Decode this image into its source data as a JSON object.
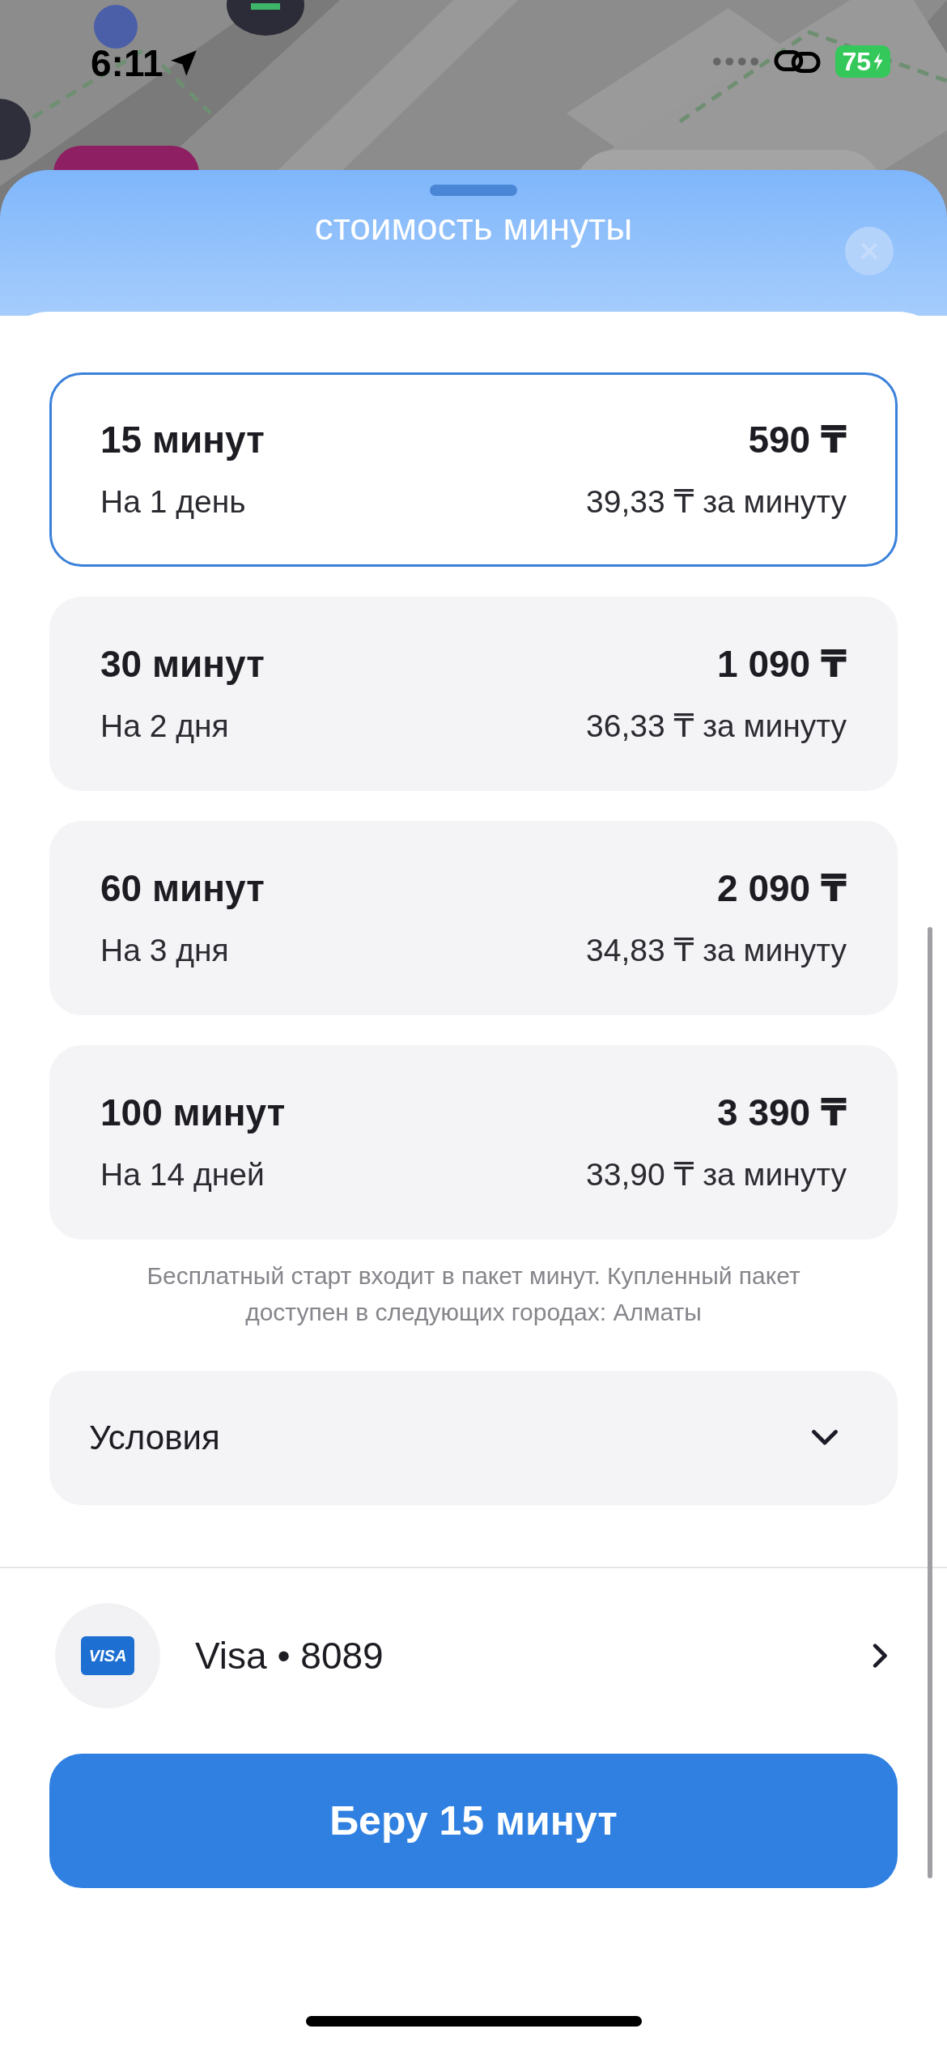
{
  "status_bar": {
    "time": "6:11",
    "battery": "75"
  },
  "sheet": {
    "title": "стоимость минуты"
  },
  "plans": [
    {
      "name": "15 минут",
      "period": "На 1 день",
      "price": "590 ₸",
      "per_minute": "39,33 ₸ за минуту",
      "selected": true
    },
    {
      "name": "30 минут",
      "period": "На 2 дня",
      "price": "1 090 ₸",
      "per_minute": "36,33 ₸ за минуту",
      "selected": false
    },
    {
      "name": "60 минут",
      "period": "На 3 дня",
      "price": "2 090 ₸",
      "per_minute": "34,83 ₸ за минуту",
      "selected": false
    },
    {
      "name": "100 минут",
      "period": "На 14 дней",
      "price": "3 390 ₸",
      "per_minute": "33,90 ₸ за минуту",
      "selected": false
    }
  ],
  "note": "Бесплатный старт входит в пакет минут. Купленный пакет доступен в следующих городах: Алматы",
  "conditions": {
    "label": "Условия",
    "expanded": false
  },
  "payment": {
    "card_brand": "VISA",
    "label": "Visa • 8089"
  },
  "action_button": "Беру 15 минут"
}
